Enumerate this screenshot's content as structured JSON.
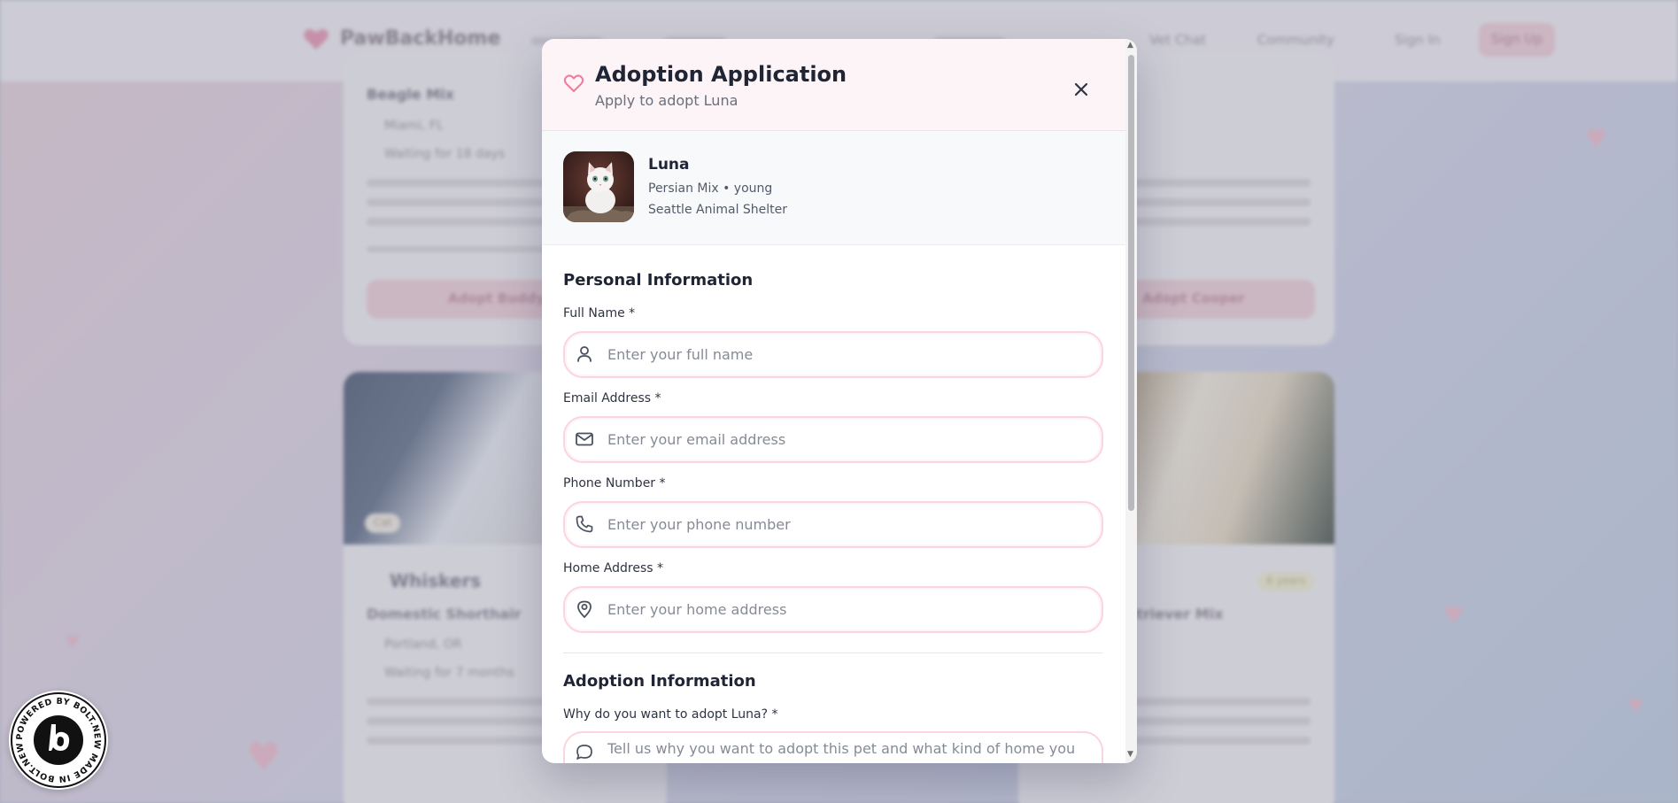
{
  "background": {
    "brand": "PawBackHome",
    "nav": [
      "Vet Chat",
      "Community"
    ],
    "sign_in": "Sign In",
    "sign_up": "Sign Up",
    "cards": {
      "card1_title": "Beagle Mix",
      "card1_location": "Miami, FL",
      "card1_waiting": "Waiting for 18 days",
      "card1_button": "Adopt Buddy",
      "card2_button": "Adopt Cooper",
      "card3_name": "Whiskers",
      "card3_breed": "Domestic Shorthair",
      "card3_location": "Portland, OR",
      "card3_waiting": "Waiting for 7 months",
      "card3_badge": "Cat",
      "card4_badge": "6 years",
      "card4_breed": "Retriever Mix"
    }
  },
  "modal": {
    "title": "Adoption Application",
    "subtitle": "Apply to adopt Luna",
    "pet": {
      "name": "Luna",
      "breed_age": "Persian Mix • young",
      "shelter": "Seattle Animal Shelter"
    },
    "personal_section": "Personal Information",
    "fields": {
      "full_name_label": "Full Name *",
      "full_name_placeholder": "Enter your full name",
      "email_label": "Email Address *",
      "email_placeholder": "Enter your email address",
      "phone_label": "Phone Number *",
      "phone_placeholder": "Enter your phone number",
      "address_label": "Home Address *",
      "address_placeholder": "Enter your home address"
    },
    "adoption_section": "Adoption Information",
    "why_label": "Why do you want to adopt Luna? *",
    "why_placeholder": "Tell us why you want to adopt this pet and what kind of home you can provide"
  },
  "badge": {
    "text": "POWERED BY BOLT.NEW MADE IN BOLT.NEW"
  },
  "colors": {
    "accent_pink": "#f27a9a",
    "title_dark": "#1f2535",
    "field_border": "#fbd4de"
  }
}
